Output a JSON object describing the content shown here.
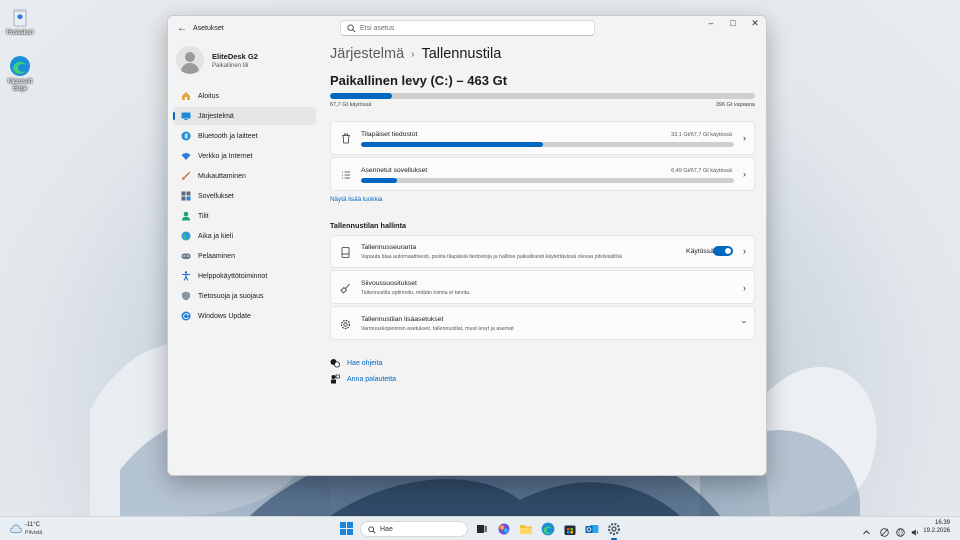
{
  "desktop": {
    "icons": [
      {
        "label": "Roskakori"
      },
      {
        "label": "Microsoft Edge"
      }
    ]
  },
  "window": {
    "app_title": "Asetukset",
    "search_placeholder": "Etsi asetus"
  },
  "profile": {
    "name": "EliteDesk G2",
    "account": "Paikallinen tili"
  },
  "sidebar": {
    "items": [
      {
        "label": "Aloitus",
        "icon": "home-icon"
      },
      {
        "label": "Järjestelmä",
        "icon": "system-icon",
        "active": true
      },
      {
        "label": "Bluetooth ja laitteet",
        "icon": "bluetooth-icon"
      },
      {
        "label": "Verkko ja Internet",
        "icon": "wifi-icon"
      },
      {
        "label": "Mukauttaminen",
        "icon": "brush-icon"
      },
      {
        "label": "Sovellukset",
        "icon": "apps-icon"
      },
      {
        "label": "Tilit",
        "icon": "account-icon"
      },
      {
        "label": "Aika ja kieli",
        "icon": "globe-icon"
      },
      {
        "label": "Pelaaminen",
        "icon": "gamepad-icon"
      },
      {
        "label": "Helppokäyttötoiminnot",
        "icon": "accessibility-icon"
      },
      {
        "label": "Tietosuoja ja suojaus",
        "icon": "shield-icon"
      },
      {
        "label": "Windows Update",
        "icon": "update-icon"
      }
    ]
  },
  "breadcrumb": {
    "parent": "Järjestelmä",
    "separator": "›",
    "current": "Tallennustila"
  },
  "drive": {
    "title": "Paikallinen levy (C:) – 463 Gt",
    "used_label": "67,7 Gt käytössä",
    "free_label": "396 Gt vapaana",
    "used_fraction": 0.146
  },
  "categories": [
    {
      "title": "Tilapäiset tiedostot",
      "meta": "33,1 Gt/67,7 Gt käytössä",
      "fraction": 0.489,
      "icon": "trash-icon"
    },
    {
      "title": "Asennetut sovellukset",
      "meta": "6,49 Gt/67,7 Gt käytössä",
      "fraction": 0.096,
      "icon": "list-icon"
    }
  ],
  "more_link": "Näytä lisää luokkia",
  "management": {
    "heading": "Tallennustilan hallinta",
    "items": [
      {
        "title": "Tallennusseuranta",
        "subtitle": "Vapauta tilaa automaattisesti, poista tilapäisiä tiedostoja ja hallitse paikallisesti käytettävissä olevaa pilvisisältöä",
        "toggle_label": "Käytössä",
        "toggle_on": true
      },
      {
        "title": "Siivoussuositukset",
        "subtitle": "Tallennustila optimoitu, mitään toimia ei tarvita."
      },
      {
        "title": "Tallennustilan lisäasetukset",
        "subtitle": "Varmuuskopioinnin asetukset, tallennustilat, muut levyt ja asemat"
      }
    ]
  },
  "help": {
    "get_help": "Hae ohjeita",
    "feedback": "Anna palautetta"
  },
  "taskbar": {
    "weather_temp": "-11°C",
    "weather_desc": "Pilvistä",
    "search_placeholder": "Hae",
    "time": "16.39",
    "date": "19.2.2026"
  },
  "colors": {
    "accent": "#0067c0",
    "bar_track": "#cfcfcf",
    "window_bg": "#f3f3f3"
  }
}
